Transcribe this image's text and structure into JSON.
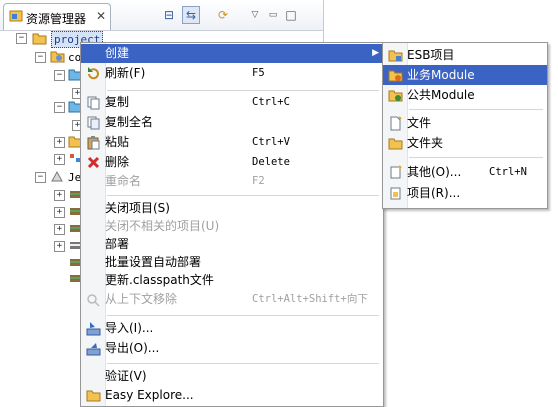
{
  "view": {
    "title": "资源管理器",
    "close_glyph": "✕",
    "toolbar": [
      {
        "name": "collapse-all-icon",
        "glyph": "⊟"
      },
      {
        "name": "link-with-editor-icon",
        "glyph": "⇆"
      },
      {
        "name": "sync-icon",
        "glyph": "⟳"
      },
      {
        "name": "view-menu-icon",
        "glyph": "▽"
      },
      {
        "name": "minimize-icon",
        "glyph": "▭"
      },
      {
        "name": "maximize-icon",
        "glyph": "□"
      }
    ]
  },
  "tree": {
    "project_label": "project",
    "partial_labels": [
      "co",
      "Je"
    ]
  },
  "context_menu": {
    "items": [
      {
        "label": "创建",
        "shortcut": "",
        "submenu": true,
        "highlighted": true,
        "disabled": false,
        "icon": ""
      },
      {
        "label": "刷新(F)",
        "shortcut": "F5",
        "icon": "refresh-icon"
      },
      {
        "label": "复制",
        "shortcut": "Ctrl+C",
        "icon": "copy-icon"
      },
      {
        "label": "复制全名",
        "shortcut": "",
        "icon": "copy-fullname-icon"
      },
      {
        "label": "粘贴",
        "shortcut": "Ctrl+V",
        "icon": "paste-icon"
      },
      {
        "label": "删除",
        "shortcut": "Delete",
        "icon": "delete-icon"
      },
      {
        "label": "重命名",
        "shortcut": "F2",
        "disabled": true,
        "icon": ""
      },
      {
        "label": "关闭项目(S)",
        "shortcut": "",
        "icon": ""
      },
      {
        "label": "关闭不相关的项目(U)",
        "shortcut": "",
        "disabled": true,
        "icon": ""
      },
      {
        "label": "部署",
        "shortcut": "",
        "icon": ""
      },
      {
        "label": "批量设置自动部署",
        "shortcut": "",
        "icon": ""
      },
      {
        "label": "更新.classpath文件",
        "shortcut": "",
        "icon": ""
      },
      {
        "label": "从上下文移除",
        "shortcut": "Ctrl+Alt+Shift+向下",
        "disabled": true,
        "icon": "remove-context-icon"
      },
      {
        "label": "导入(I)...",
        "shortcut": "",
        "icon": "import-icon"
      },
      {
        "label": "导出(O)...",
        "shortcut": "",
        "icon": "export-icon"
      },
      {
        "label": "验证(V)",
        "shortcut": "",
        "icon": ""
      },
      {
        "label": "Easy Explore...",
        "shortcut": "",
        "icon": "folder-icon"
      }
    ]
  },
  "submenu": {
    "items": [
      {
        "label": "ESB项目",
        "shortcut": "",
        "icon": "esb-project-icon"
      },
      {
        "label": "业务Module",
        "shortcut": "",
        "icon": "business-module-icon",
        "highlighted": true
      },
      {
        "label": "公共Module",
        "shortcut": "",
        "icon": "common-module-icon"
      },
      {
        "label": "文件",
        "shortcut": "",
        "icon": "file-icon"
      },
      {
        "label": "文件夹",
        "shortcut": "",
        "icon": "folder-icon"
      },
      {
        "label": "其他(O)...",
        "shortcut": "Ctrl+N",
        "icon": "other-icon"
      },
      {
        "label": "项目(R)...",
        "shortcut": "",
        "icon": "project-icon"
      }
    ]
  },
  "colors": {
    "highlight": "#3b63c4",
    "disabled_text": "#a0a0a0",
    "selection_bg": "#d6e3f7"
  }
}
